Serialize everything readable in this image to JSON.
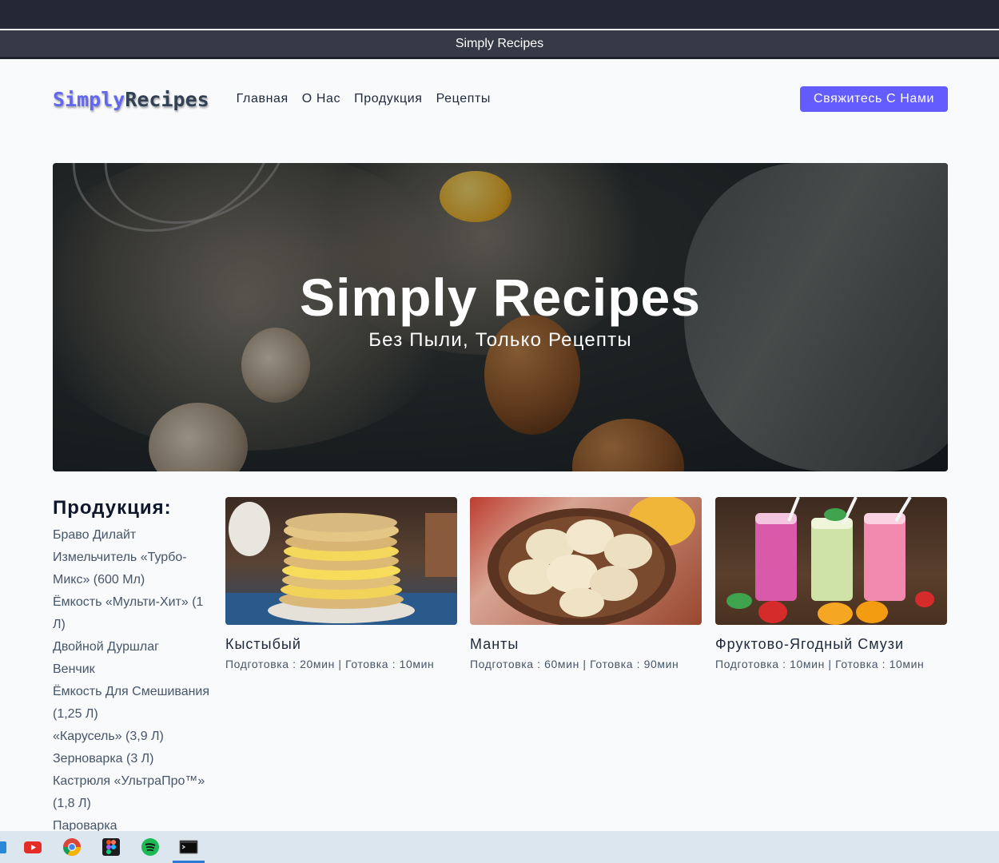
{
  "window": {
    "title": "Simply Recipes"
  },
  "navbar": {
    "logo_part1": "Simply",
    "logo_part2": "Recipes",
    "links": [
      "Главная",
      "О Нас",
      "Продукция",
      "Рецепты"
    ],
    "contact_label": "Свяжитесь С Нами"
  },
  "hero": {
    "title": "Simply Recipes",
    "subtitle": "Без Пыли, Только Рецепты"
  },
  "sidebar": {
    "title": "Продукция:",
    "items": [
      "Браво Дилайт",
      "Измельчитель «Турбо-Микс» (600 Мл)",
      "Ёмкость «Мульти-Хит» (1 Л)",
      "Двойной Дуршлаг",
      "Венчик",
      "Ёмкость Для Смешивания (1,25 Л)",
      "«Карусель» (3,9 Л)",
      "Зерноварка (3 Л)",
      "Кастрюля «УльтраПро™» (1,8 Л)",
      "Пароварка"
    ]
  },
  "recipes": [
    {
      "title": "Кыстыбый",
      "meta": "Подготовка : 20мин | Готовка : 10мин"
    },
    {
      "title": "Манты",
      "meta": "Подготовка : 60мин | Готовка : 90мин"
    },
    {
      "title": "Фруктово-Ягодный Смузи",
      "meta": "Подготовка : 10мин | Готовка : 10мин"
    }
  ],
  "taskbar": {
    "icons": [
      "file-explorer-icon",
      "youtube-icon",
      "chrome-icon",
      "figma-icon",
      "spotify-icon",
      "terminal-icon"
    ]
  },
  "colors": {
    "accent": "#645cff",
    "logo_accent": "#6366f1",
    "background": "#f8fafc"
  }
}
